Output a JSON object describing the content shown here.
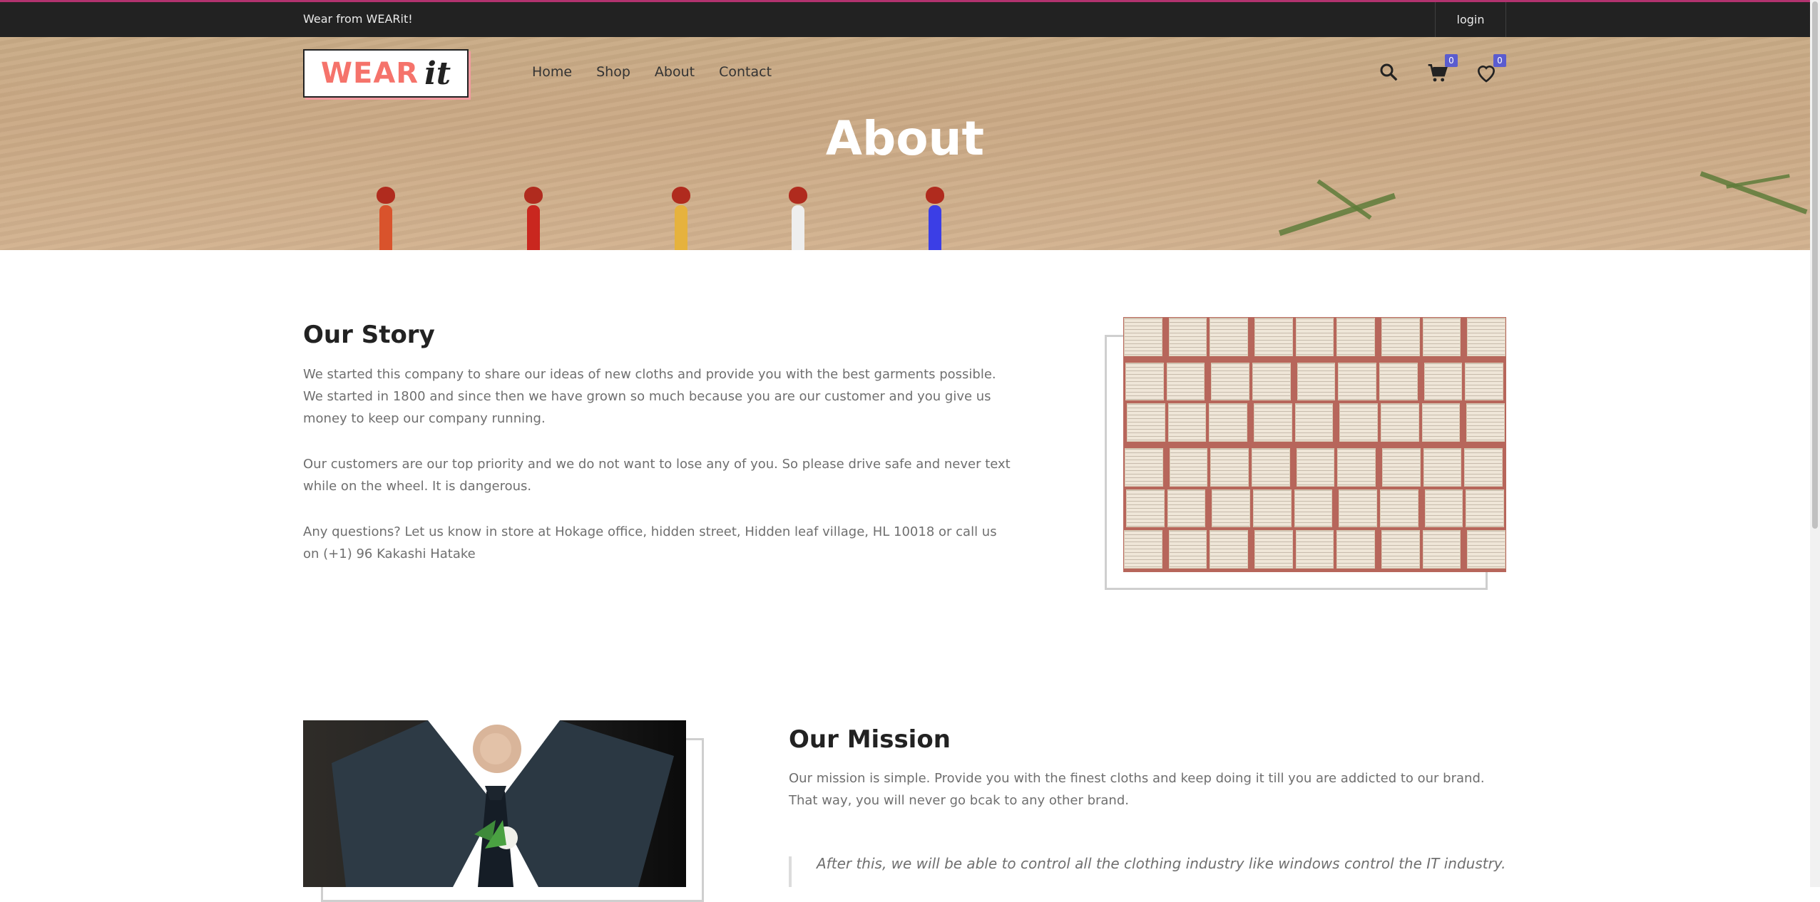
{
  "topbar": {
    "welcome": "Wear from WEARit!",
    "login": "login"
  },
  "logo": {
    "word": "WEAR",
    "it": "it"
  },
  "nav": [
    "Home",
    "Shop",
    "About",
    "Contact"
  ],
  "header_icons": {
    "search": "search-icon",
    "cart": "cart-icon",
    "wishlist": "heart-icon",
    "cart_count": "0",
    "wishlist_count": "0"
  },
  "hero": {
    "title": "About"
  },
  "story": {
    "title": "Our Story",
    "p1": "We started this company to share our ideas of new cloths and provide you with the best garments possible. We started in 1800 and since then we have grown so much because you are our customer and you give us money to keep our company running.",
    "p2": "Our customers are our top priority and we do not want to lose any of you. So please drive safe and never text while on the wheel. It is dangerous.",
    "p3": "Any questions? Let us know in store at Hokage office, hidden street, Hidden leaf village, HL 10018 or call us on (+1) 96 Kakashi Hatake"
  },
  "mission": {
    "title": "Our Mission",
    "p1": "Our mission is simple. Provide you with the finest cloths and keep doing it till you are addicted to our brand. That way, you will never go bcak to any other brand.",
    "quote": "After this, we will be able to control all the clothing industry like windows control the IT industry."
  },
  "colors": {
    "accent": "#b2336f",
    "badge": "#5a5ccf",
    "logo_red": "#f5736b",
    "topbar": "#222222"
  }
}
